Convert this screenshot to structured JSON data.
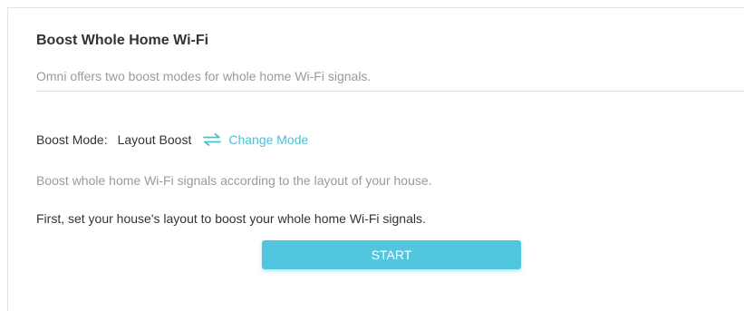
{
  "section": {
    "title": "Boost Whole Home Wi-Fi",
    "subtitle": "Omni offers two boost modes for whole home Wi-Fi signals."
  },
  "boost_mode": {
    "label": "Boost Mode:",
    "value": "Layout Boost",
    "change_label": "Change Mode",
    "change_icon": "swap-arrows-icon",
    "description": "Boost whole home Wi-Fi signals according to the layout of your house.",
    "instruction": "First, set your house's layout to boost your whole home Wi-Fi signals."
  },
  "actions": {
    "start_label": "START"
  },
  "colors": {
    "accent": "#52c6de",
    "link": "#4ac1d8",
    "muted_text": "#9a9a9a",
    "body_text": "#333333"
  }
}
